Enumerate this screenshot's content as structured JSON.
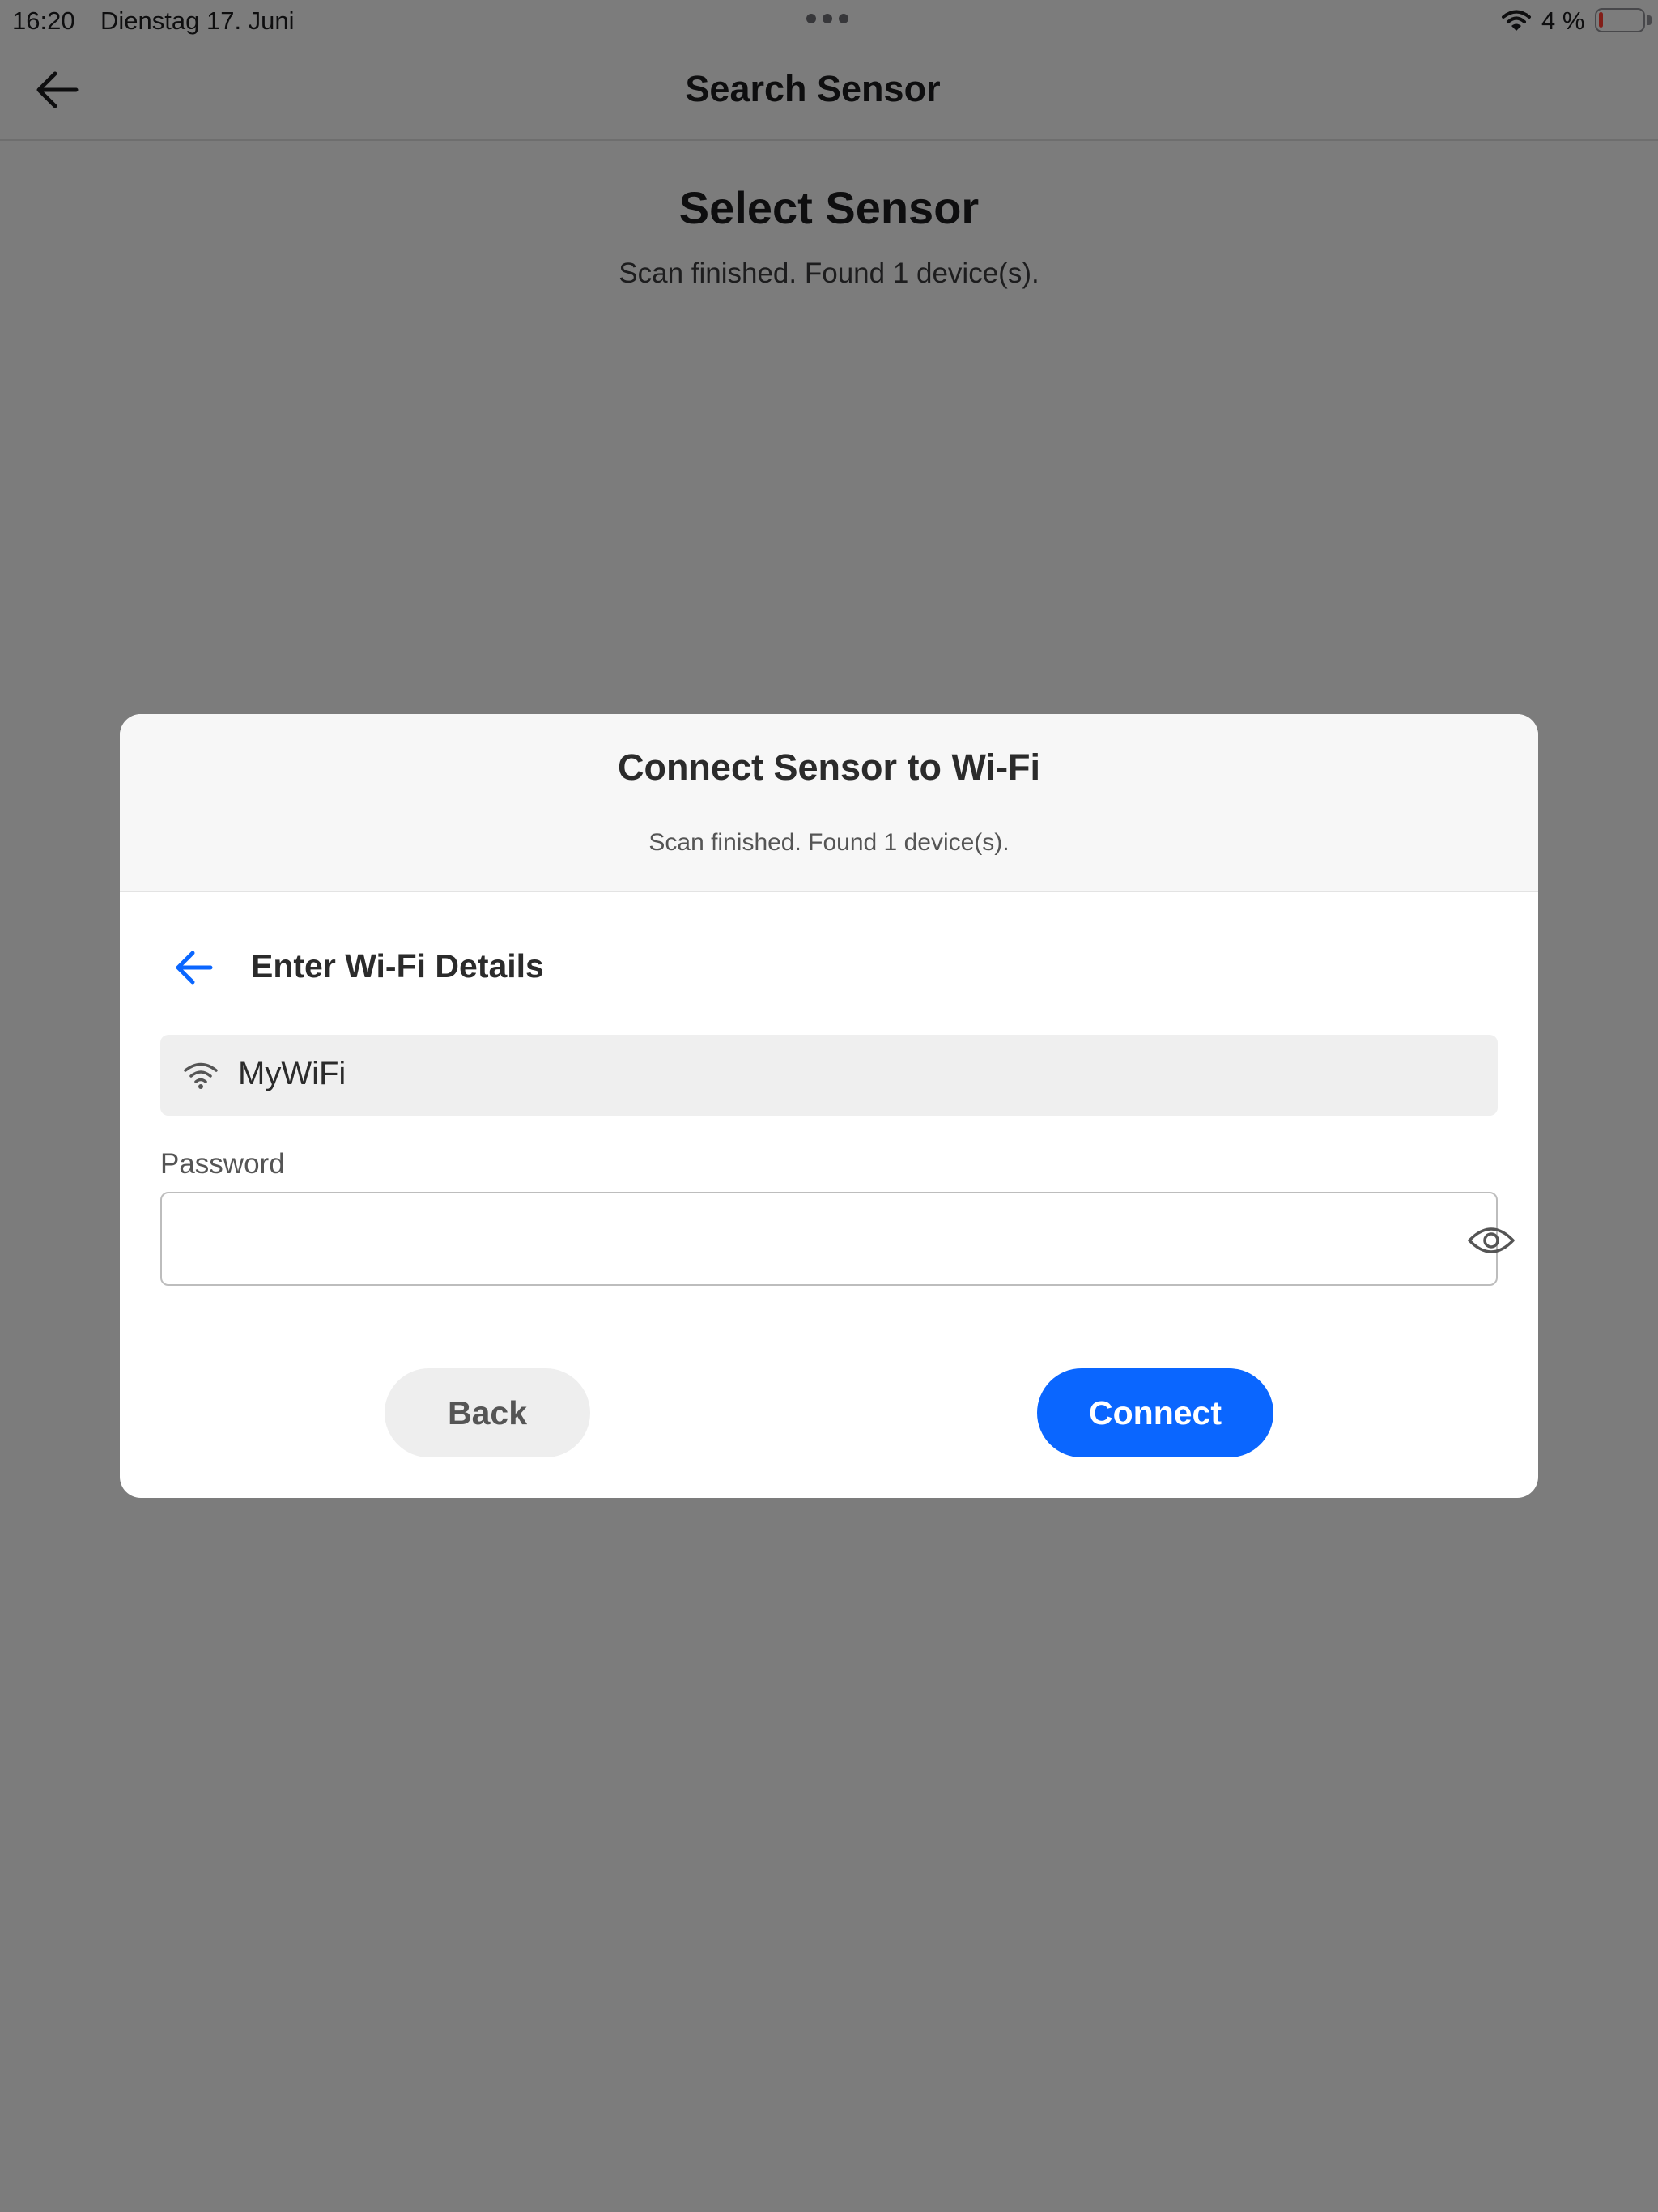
{
  "status_bar": {
    "time": "16:20",
    "date": "Dienstag 17. Juni",
    "battery_percent": "4 %",
    "battery_level": 0.04,
    "battery_color": "#ff3b30"
  },
  "nav": {
    "title": "Search Sensor",
    "back_icon": "arrow-left-icon"
  },
  "page": {
    "heading": "Select Sensor",
    "subtitle": "Scan finished. Found 1 device(s)."
  },
  "modal": {
    "title": "Connect Sensor to Wi-Fi",
    "subtitle": "Scan finished. Found 1 device(s).",
    "step_title": "Enter Wi-Fi Details",
    "step_back_icon": "arrow-left-icon",
    "ssid": {
      "icon": "wifi-icon",
      "value": "MyWiFi"
    },
    "password": {
      "label": "Password",
      "value": "",
      "visibility_icon": "eye-icon"
    },
    "buttons": {
      "back_label": "Back",
      "connect_label": "Connect"
    },
    "colors": {
      "accent": "#0a66ff",
      "secondary_button": "#eeeeee"
    }
  }
}
